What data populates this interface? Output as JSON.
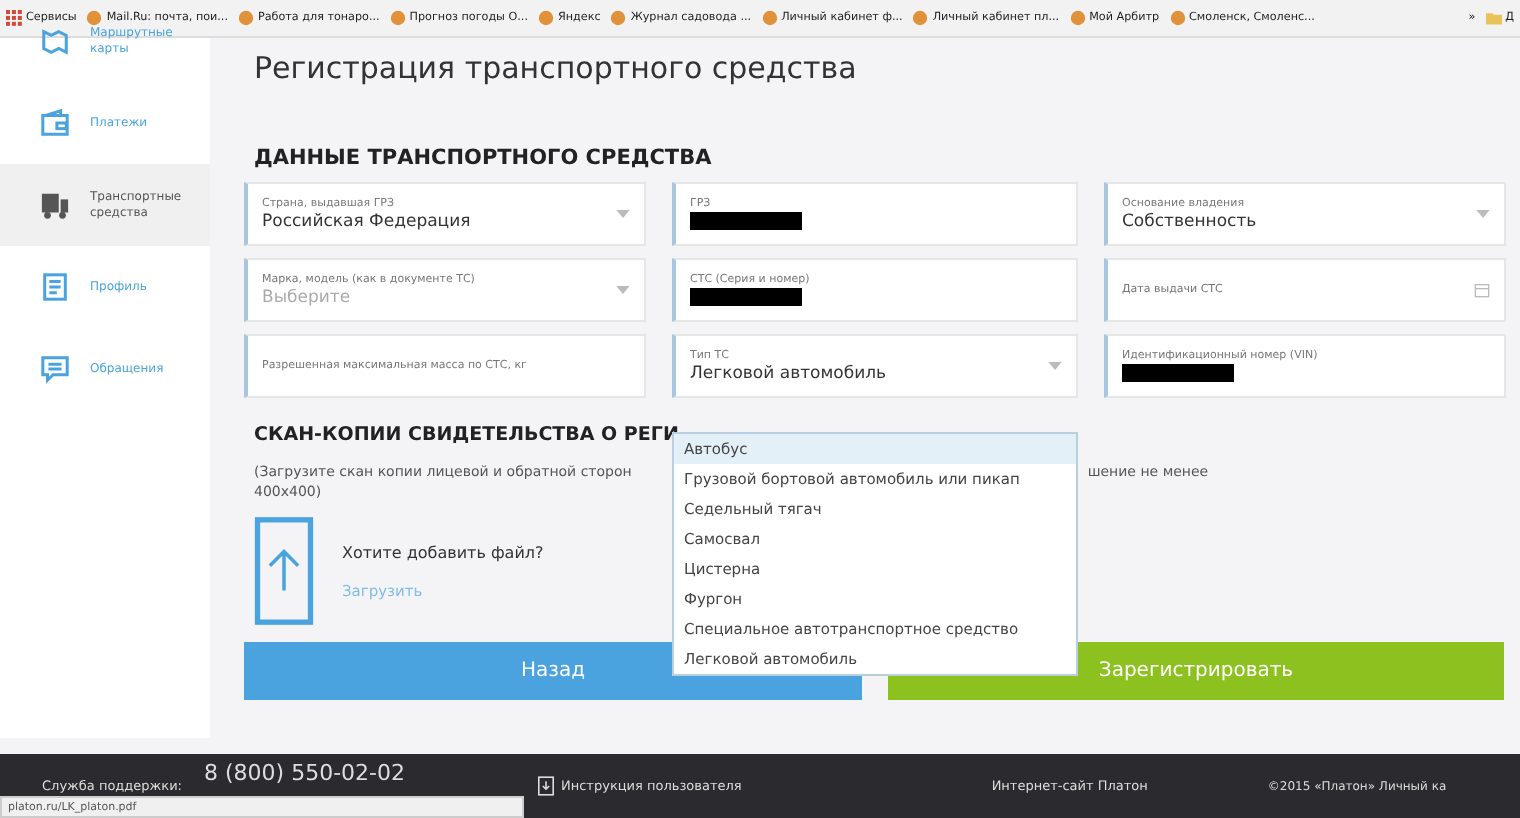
{
  "bookmarks": [
    {
      "label": "Сервисы",
      "kind": "apps"
    },
    {
      "label": "Mail.Ru: почта, пои...",
      "kind": "page"
    },
    {
      "label": "Работа для тонаро...",
      "kind": "page"
    },
    {
      "label": "Прогноз погоды О...",
      "kind": "page"
    },
    {
      "label": "Яндекс",
      "kind": "page"
    },
    {
      "label": "Журнал садовода ...",
      "kind": "page"
    },
    {
      "label": "Личный кабинет ф...",
      "kind": "page"
    },
    {
      "label": "Личный кабинет пл...",
      "kind": "page"
    },
    {
      "label": "Мой Арбитр",
      "kind": "page"
    },
    {
      "label": "Смоленск, Смоленс...",
      "kind": "page"
    }
  ],
  "bookmarks_more": "»",
  "bookmarks_folder": "Д",
  "sidebar": {
    "items": [
      {
        "label": "Маршрутные карты",
        "kind": "map",
        "selected": false
      },
      {
        "label": "Платежи",
        "kind": "wallet",
        "selected": false
      },
      {
        "label": "Транспортные средства",
        "kind": "truck",
        "selected": true
      },
      {
        "label": "Профиль",
        "kind": "profile",
        "selected": false
      },
      {
        "label": "Обращения",
        "kind": "chat",
        "selected": false
      }
    ]
  },
  "page_title": "Регистрация транспортного средства",
  "section_title": "ДАННЫЕ ТРАНСПОРТНОГО СРЕДСТВА",
  "fields": [
    {
      "kind": "select",
      "label": "Страна, выдавшая ГРЗ",
      "value": "Российская Федерация"
    },
    {
      "kind": "text",
      "label": "ГРЗ",
      "redacted": true
    },
    {
      "kind": "select",
      "label": "Основание владения",
      "value": "Собственность"
    },
    {
      "kind": "select",
      "label": "Марка, модель (как в документе ТС)",
      "placeholder": "Выберите"
    },
    {
      "kind": "text",
      "label": "СТС (Серия и номер)",
      "redacted": true
    },
    {
      "kind": "date",
      "label": "Дата выдачи СТС"
    },
    {
      "kind": "text",
      "label": "Разрешенная максимальная масса по СТС, кг"
    },
    {
      "kind": "select",
      "label": "Тип ТС",
      "value": "Легковой автомобиль"
    },
    {
      "kind": "text",
      "label": "Идентификационный номер (VIN)",
      "redacted": true
    }
  ],
  "dropdown": {
    "options": [
      {
        "label": "Автобус",
        "selected": true
      },
      {
        "label": "Грузовой бортовой автомобиль или пикап",
        "selected": false
      },
      {
        "label": "Седельный тягач",
        "selected": false
      },
      {
        "label": "Самосвал",
        "selected": false
      },
      {
        "label": "Цистерна",
        "selected": false
      },
      {
        "label": "Фургон",
        "selected": false
      },
      {
        "label": "Специальное автотранспортное средство",
        "selected": false
      },
      {
        "label": "Легковой автомобиль",
        "selected": false
      }
    ]
  },
  "scan_section": {
    "title": "СКАН-КОПИИ СВИДЕТЕЛЬСТВА О РЕГИ",
    "hint_left": "(Загрузите скан копии лицевой и обратной сторон",
    "hint_right": "шение не менее",
    "hint_line2": "400x400)",
    "upload_question": "Хотите добавить файл?",
    "upload_link": "Загрузить"
  },
  "buttons": {
    "back": "Назад",
    "register": "Зарегистрировать"
  },
  "footer": {
    "support_label": "Служба поддержки:",
    "phone": "8 (800) 550-02-02",
    "manual": "Инструкция пользователя",
    "site": "Интернет-сайт Платон",
    "copyright": "©2015 «Платон» Личный ка"
  },
  "status_url": "platon.ru/LK_platon.pdf"
}
